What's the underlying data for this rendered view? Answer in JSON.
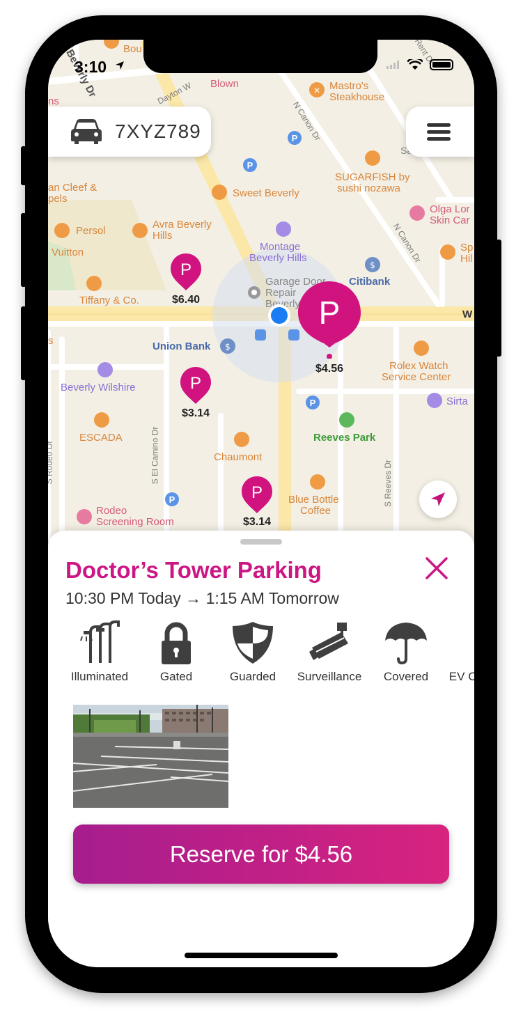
{
  "status_bar": {
    "time": "3:10"
  },
  "vehicle": {
    "plate": "7XYZ789"
  },
  "map": {
    "labels": {
      "blown": "Blown",
      "mastros_1": "Mastro's",
      "mastros_2": "Steakhouse",
      "street_dayton": "Dayton W",
      "street_beverly": "Beverly Dr",
      "street_ncanon_top": "N Canon Dr",
      "street_ncanon_right": "N Canon Dr",
      "sugarfish_1": "SUGARFISH by",
      "sugarfish_2": "sushi nozawa",
      "sweet_beverly": "Sweet Beverly",
      "vancleef_1": "an Cleef &",
      "vancleef_2": "pels",
      "olga_1": "Olga Lor",
      "olga_2": "Skin Car",
      "persol": "Persol",
      "avra_1": "Avra Beverly",
      "avra_2": "Hills",
      "vuitton": "Vuitton",
      "montage_1": "Montage",
      "montage_2": "Beverly Hills",
      "sp_1": "Sp",
      "sp_2": "Hil",
      "garage_1": "Garage Door",
      "garage_2": "Repair",
      "garage_3": "Beverly",
      "citibank": "Citibank",
      "tiffany": "Tiffany & Co.",
      "wilshire": "W",
      "union_bank": "Union Bank",
      "rolex_1": "Rolex Watch",
      "rolex_2": "Service Center",
      "beverly_wilshire": "Beverly Wilshire",
      "sirta": "Sirta",
      "escada": "ESCADA",
      "reeves_park": "Reeves Park",
      "chaumont": "Chaumont",
      "street_elcamino": "S El Camino Dr",
      "street_sreeves": "S Reeves Dr",
      "street_left": "S Rodeo Dr",
      "blue_bottle_1": "Blue Bottle",
      "blue_bottle_2": "Coffee",
      "rodeo_1": "Rodeo",
      "rodeo_2": "Screening Room",
      "bou": "Bou",
      "sa": "Sa",
      "ns": "ns",
      "s_left": "s",
      "top_right": "Rent Dr"
    },
    "pins": [
      {
        "price": "$6.40"
      },
      {
        "price": "$4.56"
      },
      {
        "price": "$3.14"
      },
      {
        "price": "$3.14"
      }
    ],
    "pin_letter": "P"
  },
  "parking": {
    "name": "Doctor’s Tower Parking",
    "time_range": "10:30 PM Today → 1:15 AM Tomorrow",
    "amenities": [
      {
        "label": "Illuminated",
        "icon": "street-light-icon"
      },
      {
        "label": "Gated",
        "icon": "lock-icon"
      },
      {
        "label": "Guarded",
        "icon": "shield-icon"
      },
      {
        "label": "Surveillance",
        "icon": "camera-icon"
      },
      {
        "label": "Covered",
        "icon": "umbrella-icon"
      },
      {
        "label": "EV Charging",
        "icon": "ev-charger-icon"
      }
    ],
    "reserve_label": "Reserve for $4.56"
  },
  "colors": {
    "accent": "#cc1683",
    "location_dot": "#1a7df3"
  }
}
